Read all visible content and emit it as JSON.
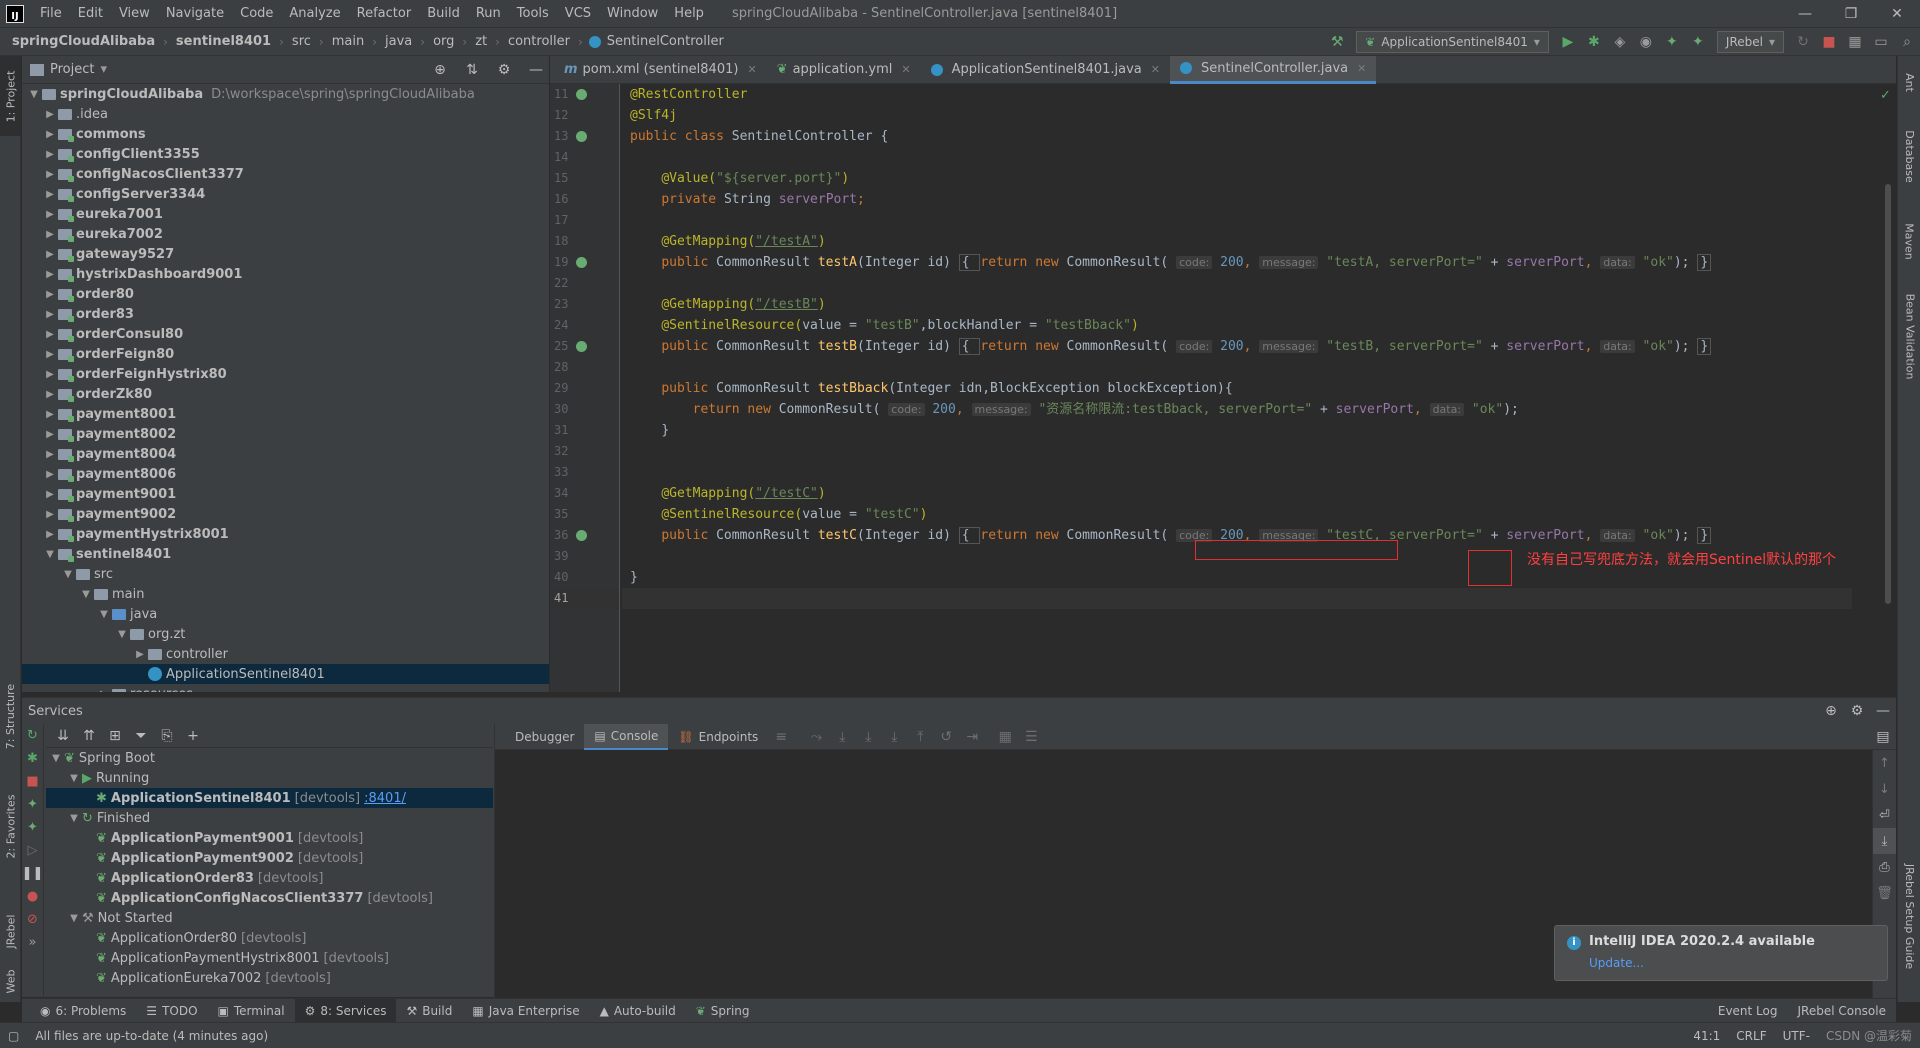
{
  "menubar": {
    "logo": "IJ",
    "items": [
      "File",
      "Edit",
      "View",
      "Navigate",
      "Code",
      "Analyze",
      "Refactor",
      "Build",
      "Run",
      "Tools",
      "VCS",
      "Window",
      "Help"
    ],
    "window_title": "springCloudAlibaba - SentinelController.java [sentinel8401]"
  },
  "navbar": {
    "crumbs": [
      "springCloudAlibaba",
      "sentinel8401",
      "src",
      "main",
      "java",
      "org",
      "zt",
      "controller",
      "SentinelController"
    ],
    "run_config": "ApplicationSentinel8401",
    "jrebel": "JRebel"
  },
  "left_tabs": [
    "1: Project",
    "7: Structure",
    "2: Favorites",
    "JRebel",
    "Web"
  ],
  "right_tabs": [
    "Ant",
    "Database",
    "Maven",
    "Bean Validation",
    "JRebel Setup Guide"
  ],
  "project": {
    "title": "Project",
    "root": {
      "name": "springCloudAlibaba",
      "path": "D:\\workspace\\spring\\springCloudAlibaba"
    },
    "items": [
      ".idea",
      "commons",
      "configClient3355",
      "configNacosClient3377",
      "configServer3344",
      "eureka7001",
      "eureka7002",
      "gateway9527",
      "hystrixDashboard9001",
      "order80",
      "order83",
      "orderConsul80",
      "orderFeign80",
      "orderFeignHystrix80",
      "orderZk80",
      "payment8001",
      "payment8002",
      "payment8004",
      "payment8006",
      "payment9001",
      "payment9002",
      "paymentHystrix8001",
      "sentinel8401"
    ],
    "sub": [
      "src",
      "main",
      "java",
      "org.zt",
      "controller",
      "ApplicationSentinel8401",
      "resources"
    ]
  },
  "editor": {
    "tabs": [
      "pom.xml (sentinel8401)",
      "application.yml",
      "ApplicationSentinel8401.java",
      "SentinelController.java"
    ],
    "line_numbers": [
      "11",
      "12",
      "13",
      "14",
      "15",
      "16",
      "17",
      "18",
      "19",
      "22",
      "23",
      "24",
      "25",
      "28",
      "29",
      "30",
      "31",
      "32",
      "33",
      "34",
      "35",
      "36",
      "39",
      "40",
      "41"
    ],
    "annotation": "没有自己写兜底方法，就会用Sentinel默认的那个",
    "code": {
      "l11": "@RestController",
      "l12": "@Slf4j",
      "l13a": "public class ",
      "l13b": "SentinelController {",
      "l15a": "@Value(",
      "l15b": "\"${server.port}\"",
      "l15c": ")",
      "l16a": "private ",
      "l16b": "String ",
      "l16c": "serverPort",
      "l16d": ";",
      "l18a": "@GetMapping(",
      "l18b": "\"/testA\"",
      "l18c": ")",
      "l19a": "public ",
      "l19b": "CommonResult ",
      "l19c": "testA",
      "l19d": "(Integer id) ",
      "l19e": "{ ",
      "l19f": "return new ",
      "l19g": "CommonResult( ",
      "h_code": "code:",
      "v200": "200",
      "h_msg": "message:",
      "l19h": "\"testA, serverPort=\"",
      "plus": " + ",
      "sp": "serverPort",
      "h_data": "data:",
      "ok": "\"ok\"",
      "end": ");",
      "rb": "}",
      "comma": ", ",
      "l23b": "\"/testB\"",
      "l24a": "@SentinelResource(",
      "l24b": "value = ",
      "l24c": "\"testB\"",
      "l24d": ",blockHandler = ",
      "l24e": "\"testBback\"",
      "l24f": ")",
      "l25c": "testB",
      "l25h": "\"testB, serverPort=\"",
      "l29c": "testBback",
      "l29d": "(Integer idn,BlockException blockException){",
      "l30a": "return new ",
      "l30b": "CommonResult( ",
      "l30c": "\"资源名称限流:testBback, serverPort=\"",
      "l30d": "\"ok\"",
      "l34b": "\"/testC\"",
      "l35c": "\"testC\"",
      "l36c": "testC",
      "l36h": "\"testC, serverPort=\"",
      "l40": "}"
    }
  },
  "services": {
    "title": "Services",
    "tabs": [
      "Debugger",
      "Console",
      "Endpoints"
    ],
    "spring_boot": "Spring Boot",
    "running": "Running",
    "running_items": [
      {
        "name": "ApplicationSentinel8401",
        "tag": "[devtools]",
        "port": ":8401/"
      }
    ],
    "finished": "Finished",
    "finished_items": [
      {
        "name": "ApplicationPayment9001",
        "tag": "[devtools]"
      },
      {
        "name": "ApplicationPayment9002",
        "tag": "[devtools]"
      },
      {
        "name": "ApplicationOrder83",
        "tag": "[devtools]"
      },
      {
        "name": "ApplicationConfigNacosClient3377",
        "tag": "[devtools]"
      }
    ],
    "not_started": "Not Started",
    "not_started_items": [
      {
        "name": "ApplicationOrder80",
        "tag": "[devtools]"
      },
      {
        "name": "ApplicationPaymentHystrix8001",
        "tag": "[devtools]"
      },
      {
        "name": "ApplicationEureka7002",
        "tag": "[devtools]"
      }
    ]
  },
  "notification": {
    "title": "IntelliJ IDEA 2020.2.4 available",
    "link": "Update..."
  },
  "bottom_tabs": [
    "6: Problems",
    "TODO",
    "Terminal",
    "8: Services",
    "Build",
    "Java Enterprise",
    "Auto-build",
    "Spring"
  ],
  "bottom_right": [
    "Event Log",
    "JRebel Console"
  ],
  "status": {
    "message": "All files are up-to-date (4 minutes ago)",
    "position": "41:1",
    "line_sep": "CRLF",
    "encoding": "UTF-",
    "watermark": "CSDN @温彩菊"
  }
}
